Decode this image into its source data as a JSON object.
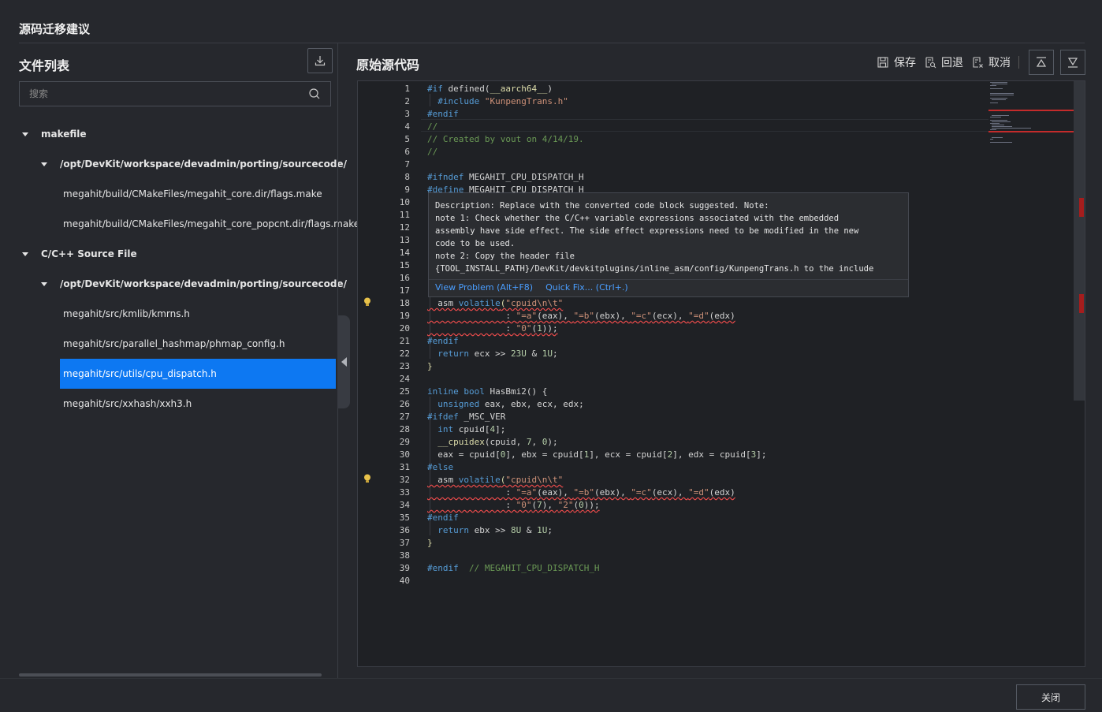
{
  "dialog": {
    "title": "源码迁移建议",
    "close_label": "关闭"
  },
  "file_list": {
    "title": "文件列表",
    "search_placeholder": "搜索",
    "groups": [
      {
        "label": "makefile",
        "folder": "/opt/DevKit/workspace/devadmin/porting/sourcecode/",
        "files": [
          "megahit/build/CMakeFiles/megahit_core.dir/flags.make",
          "megahit/build/CMakeFiles/megahit_core_popcnt.dir/flags.make"
        ]
      },
      {
        "label": "C/C++ Source File",
        "folder": "/opt/DevKit/workspace/devadmin/porting/sourcecode/",
        "files": [
          "megahit/src/kmlib/kmrns.h",
          "megahit/src/parallel_hashmap/phmap_config.h",
          "megahit/src/utils/cpu_dispatch.h",
          "megahit/src/xxhash/xxh3.h"
        ]
      }
    ],
    "selected_file": "megahit/src/utils/cpu_dispatch.h"
  },
  "editor": {
    "title": "原始源代码",
    "toolbar": {
      "save": "保存",
      "revert": "回退",
      "cancel": "取消"
    },
    "hover": {
      "lines": [
        "Description: Replace with the converted code block suggested. Note:",
        "note 1: Check whether the C/C++ variable expressions associated with the embedded",
        "assembly have side effect. The side effect expressions need to be modified in the new",
        "code to be used.",
        "note 2: Copy the header file",
        "{TOOL_INSTALL_PATH}/DevKit/devkitplugins/inline_asm/config/KunpengTrans.h to the include"
      ],
      "view_problem": "View Problem (Alt+F8)",
      "quick_fix": "Quick Fix... (Ctrl+.)"
    },
    "line_numbers": [
      "1",
      "2",
      "3",
      "4",
      "5",
      "6",
      "7",
      "8",
      "9",
      "10",
      "11",
      "12",
      "13",
      "14",
      "15",
      "16",
      "17",
      "18",
      "19",
      "20",
      "21",
      "22",
      "23",
      "24",
      "25",
      "26",
      "27",
      "28",
      "29",
      "30",
      "31",
      "32",
      "33",
      "34",
      "35",
      "36",
      "37",
      "38",
      "39",
      "40"
    ],
    "code": {
      "l1": [
        "#if",
        " defined(",
        "__aarch64__",
        ")"
      ],
      "l2": [
        "  #include ",
        "\"KunpengTrans.h\""
      ],
      "l3": "#endif",
      "l4": "//",
      "l5": "// Created by vout on 4/14/19.",
      "l6": "//",
      "l8": [
        "#ifndef",
        " MEGAHIT_CPU_DISPATCH_H"
      ],
      "l9": [
        "#define",
        " MEGAHIT_CPU_DISPATCH_H"
      ],
      "l18": [
        "  asm ",
        "volatile",
        "(",
        "\"cpuid\\n\\t\""
      ],
      "l19": [
        "               : ",
        "\"=a\"",
        "(eax), ",
        "\"=b\"",
        "(ebx), ",
        "\"=c\"",
        "(ecx), ",
        "\"=d\"",
        "(edx)"
      ],
      "l20": [
        "               : ",
        "\"0\"",
        "(",
        "1",
        "));"
      ],
      "l21": "#endif",
      "l22": [
        "  return",
        " ecx >> ",
        "23U",
        " & ",
        "1U",
        ";"
      ],
      "l23": "}",
      "l25": [
        "inline",
        " ",
        "bool",
        " HasBmi2() {"
      ],
      "l26": [
        "  unsigned",
        " eax, ebx, ecx, edx;"
      ],
      "l27": [
        "#ifdef",
        " _MSC_VER"
      ],
      "l28": [
        "  int",
        " cpuid[",
        "4",
        "];"
      ],
      "l29": [
        "  __cpuidex",
        "(cpuid, ",
        "7",
        ", ",
        "0",
        ");"
      ],
      "l30": [
        "  eax = cpuid[",
        "0",
        "], ebx = cpuid[",
        "1",
        "], ecx = cpuid[",
        "2",
        "], edx = cpuid[",
        "3",
        "];"
      ],
      "l31": "#else",
      "l32": [
        "  asm ",
        "volatile",
        "(",
        "\"cpuid\\n\\t\""
      ],
      "l33": [
        "               : ",
        "\"=a\"",
        "(eax), ",
        "\"=b\"",
        "(ebx), ",
        "\"=c\"",
        "(ecx), ",
        "\"=d\"",
        "(edx)"
      ],
      "l34": [
        "               : ",
        "\"0\"",
        "(",
        "7",
        "), ",
        "\"2\"",
        "(",
        "0",
        "));"
      ],
      "l35": "#endif",
      "l36": [
        "  return",
        " ebx >> ",
        "8U",
        " & ",
        "1U",
        ";"
      ],
      "l37": "}",
      "l39": [
        "#endif",
        "  // MEGAHIT_CPU_DISPATCH_H"
      ]
    }
  },
  "colors": {
    "accent": "#0d78f2",
    "background": "#26282d",
    "editor_bg": "#1f2125",
    "error": "#f14c4c",
    "link": "#4a9eff"
  },
  "icons": [
    "download-icon",
    "search-icon",
    "save-icon",
    "revert-icon",
    "cancel-icon",
    "collapse-up-icon",
    "collapse-down-icon",
    "lightbulb-icon",
    "chevron-left-icon"
  ]
}
